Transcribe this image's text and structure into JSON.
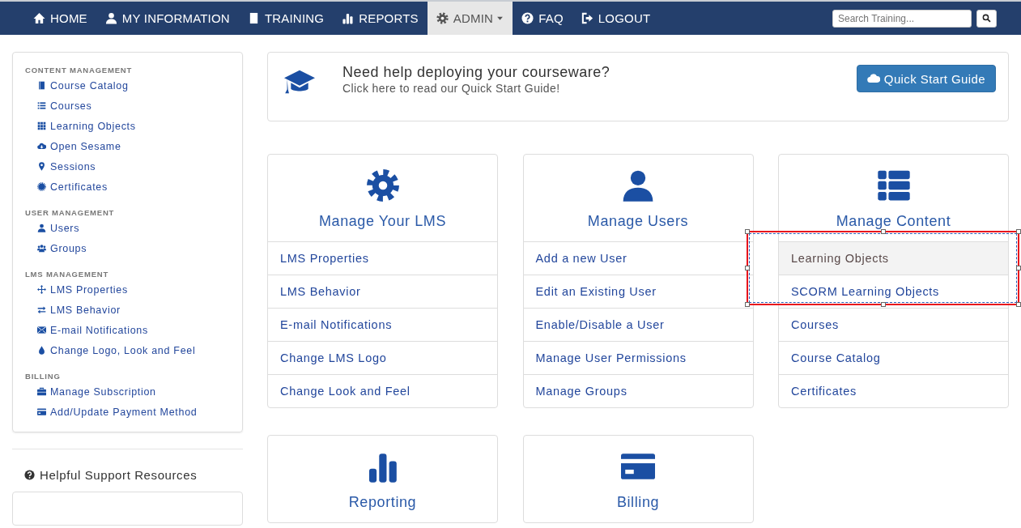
{
  "navbar": {
    "items": [
      {
        "label": "HOME",
        "selected": false
      },
      {
        "label": "MY INFORMATION",
        "selected": false
      },
      {
        "label": "TRAINING",
        "selected": false
      },
      {
        "label": "REPORTS",
        "selected": false
      },
      {
        "label": "ADMIN",
        "selected": true
      },
      {
        "label": "FAQ",
        "selected": false
      },
      {
        "label": "LOGOUT",
        "selected": false
      }
    ],
    "search": {
      "placeholder": "Search Training..."
    }
  },
  "sidebar": {
    "sections": [
      {
        "heading": "CONTENT MANAGEMENT",
        "items": [
          "Course Catalog",
          "Courses",
          "Learning Objects",
          "Open Sesame",
          "Sessions",
          "Certificates"
        ]
      },
      {
        "heading": "USER MANAGEMENT",
        "items": [
          "Users",
          "Groups"
        ]
      },
      {
        "heading": "LMS MANAGEMENT",
        "items": [
          "LMS Properties",
          "LMS Behavior",
          "E-mail Notifications",
          "Change Logo, Look and Feel"
        ]
      },
      {
        "heading": "BILLING",
        "items": [
          "Manage Subscription",
          "Add/Update Payment Method"
        ]
      }
    ],
    "support_title": "Helpful Support Resources"
  },
  "banner": {
    "title": "Need help deploying your courseware?",
    "subtitle": "Click here to read our Quick Start Guide!",
    "button": "Quick Start Guide"
  },
  "cards": [
    {
      "title": "Manage Your LMS",
      "links": [
        {
          "label": "LMS Properties",
          "selected": false
        },
        {
          "label": "LMS Behavior",
          "selected": false
        },
        {
          "label": "E-mail Notifications",
          "selected": false
        },
        {
          "label": "Change LMS Logo",
          "selected": false
        },
        {
          "label": "Change Look and Feel",
          "selected": false
        }
      ]
    },
    {
      "title": "Manage Users",
      "links": [
        {
          "label": "Add a new User",
          "selected": false
        },
        {
          "label": "Edit an Existing User",
          "selected": false
        },
        {
          "label": "Enable/Disable a User",
          "selected": false
        },
        {
          "label": "Manage User Permissions",
          "selected": false
        },
        {
          "label": "Manage Groups",
          "selected": false
        }
      ]
    },
    {
      "title": "Manage Content",
      "links": [
        {
          "label": "Learning Objects",
          "selected": true
        },
        {
          "label": "SCORM Learning Objects",
          "selected": false
        },
        {
          "label": "Courses",
          "selected": false
        },
        {
          "label": "Course Catalog",
          "selected": false
        },
        {
          "label": "Certificates",
          "selected": false
        }
      ]
    },
    {
      "title": "Reporting"
    },
    {
      "title": "Billing"
    }
  ]
}
